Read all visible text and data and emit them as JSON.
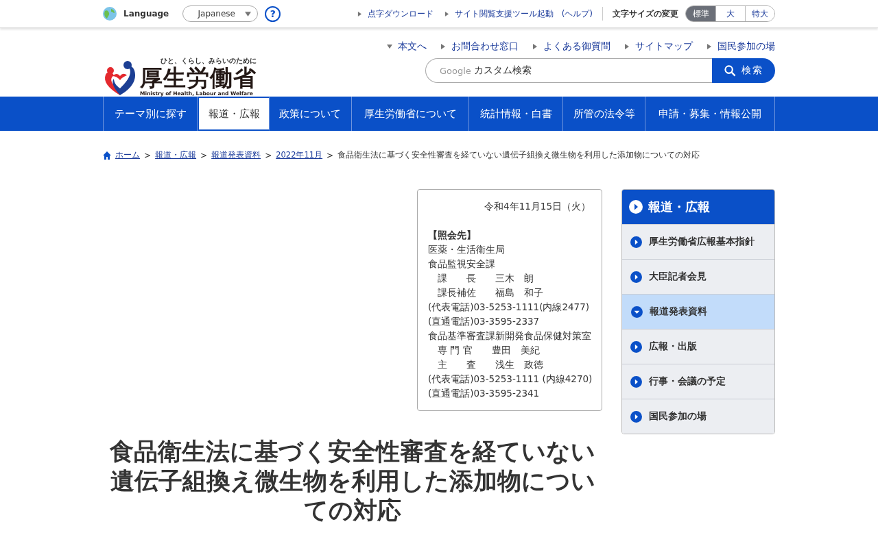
{
  "utility_bar": {
    "language_label": "Language",
    "language_select": "Japanese",
    "help": "?",
    "links": [
      {
        "label": "点字ダウンロード"
      },
      {
        "label": "サイト閲覧支援ツール起動　(ヘルプ)"
      }
    ],
    "font_size_label": "文字サイズの変更",
    "font_sizes": [
      {
        "label": "標準",
        "selected": true
      },
      {
        "label": "大",
        "selected": false
      },
      {
        "label": "特大",
        "selected": false
      }
    ]
  },
  "logo": {
    "tagline": "ひと、くらし、みらいのために",
    "name": "厚生労働省",
    "english": "Ministry of Health, Labour and Welfare"
  },
  "header_links": [
    {
      "label": "本文へ",
      "kind": "down"
    },
    {
      "label": "お問合わせ窓口",
      "kind": "right"
    },
    {
      "label": "よくある御質問",
      "kind": "right"
    },
    {
      "label": "サイトマップ",
      "kind": "right"
    },
    {
      "label": "国民参加の場",
      "kind": "right"
    }
  ],
  "search": {
    "brand": "Google",
    "placeholder": "カスタム検索",
    "button": "検索"
  },
  "nav": [
    {
      "label": "テーマ別に探す",
      "selected": false
    },
    {
      "label": "報道・広報",
      "selected": true
    },
    {
      "label": "政策について",
      "selected": false
    },
    {
      "label": "厚生労働省について",
      "selected": false
    },
    {
      "label": "統計情報・白書",
      "selected": false
    },
    {
      "label": "所管の法令等",
      "selected": false
    },
    {
      "label": "申請・募集・情報公開",
      "selected": false
    }
  ],
  "breadcrumb_separator": ">",
  "breadcrumb": [
    {
      "label": "ホーム"
    },
    {
      "label": "報道・広報"
    },
    {
      "label": "報道発表資料"
    },
    {
      "label": "2022年11月"
    }
  ],
  "breadcrumb_current": "食品衛生法に基づく安全性審査を経ていない遺伝子組換え微生物を利用した添加物についての対応",
  "contact": {
    "date": "令和4年11月15日（火）",
    "heading": "【照会先】",
    "lines": [
      "医薬・生活衛生局",
      "食品監視安全課",
      "　課　　長　　三木　朗",
      "　課長補佐　　福島　和子",
      "(代表電話)03-5253-1111(内線2477)",
      "(直通電話)03-3595-2337",
      "食品基準審査課新開発食品保健対策室",
      "　専 門 官　　豊田　美紀",
      "　主　　査　　浅生　政徳",
      "(代表電話)03-5253-1111 (内線4270)",
      "(直通電話)03-3595-2341"
    ]
  },
  "title": "食品衛生法に基づく安全性審査を経ていない遺伝子組換え微生物を利用した添加物についての対応",
  "side_menu": {
    "title": "報道・広報",
    "items": [
      {
        "label": "厚生労働省広報基本指針",
        "selected": false
      },
      {
        "label": "大臣記者会見",
        "selected": false
      },
      {
        "label": "報道発表資料",
        "selected": true
      },
      {
        "label": "広報・出版",
        "selected": false
      },
      {
        "label": "行事・会議の予定",
        "selected": false
      },
      {
        "label": "国民参加の場",
        "selected": false
      }
    ]
  }
}
